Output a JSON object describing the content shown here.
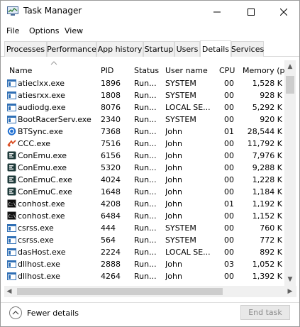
{
  "window": {
    "title": "Task Manager",
    "controls": {
      "minimize": "—",
      "maximize": "☐",
      "close": "✕"
    }
  },
  "menu": [
    "File",
    "Options",
    "View"
  ],
  "tabs": [
    {
      "label": "Processes",
      "active": false
    },
    {
      "label": "Performance",
      "active": false
    },
    {
      "label": "App history",
      "active": false
    },
    {
      "label": "Startup",
      "active": false
    },
    {
      "label": "Users",
      "active": false
    },
    {
      "label": "Details",
      "active": true
    },
    {
      "label": "Services",
      "active": false
    }
  ],
  "columns": {
    "name": "Name",
    "pid": "PID",
    "status": "Status",
    "user": "User name",
    "cpu": "CPU",
    "memory": "Memory (p..."
  },
  "rows": [
    {
      "icon": "window-app-icon",
      "name": "atieclxx.exe",
      "pid": "1896",
      "status": "Run...",
      "user": "SYSTEM",
      "cpu": "00",
      "memory": "1,528 K"
    },
    {
      "icon": "window-app-icon",
      "name": "atiesrxx.exe",
      "pid": "1808",
      "status": "Run...",
      "user": "SYSTEM",
      "cpu": "00",
      "memory": "928 K"
    },
    {
      "icon": "window-app-icon",
      "name": "audiodg.exe",
      "pid": "8076",
      "status": "Run...",
      "user": "LOCAL SE...",
      "cpu": "00",
      "memory": "5,292 K"
    },
    {
      "icon": "window-app-icon",
      "name": "BootRacerServ.exe",
      "pid": "2340",
      "status": "Run...",
      "user": "SYSTEM",
      "cpu": "00",
      "memory": "920 K"
    },
    {
      "icon": "btsync-icon",
      "name": "BTSync.exe",
      "pid": "7368",
      "status": "Run...",
      "user": "John",
      "cpu": "01",
      "memory": "28,544 K"
    },
    {
      "icon": "ccc-icon",
      "name": "CCC.exe",
      "pid": "7516",
      "status": "Run...",
      "user": "John",
      "cpu": "00",
      "memory": "11,792 K"
    },
    {
      "icon": "conemu-icon",
      "name": "ConEmu.exe",
      "pid": "6156",
      "status": "Run...",
      "user": "John",
      "cpu": "00",
      "memory": "7,976 K"
    },
    {
      "icon": "conemu-icon",
      "name": "ConEmu.exe",
      "pid": "5320",
      "status": "Run...",
      "user": "John",
      "cpu": "00",
      "memory": "9,288 K"
    },
    {
      "icon": "conemu-icon",
      "name": "ConEmuC.exe",
      "pid": "4024",
      "status": "Run...",
      "user": "John",
      "cpu": "00",
      "memory": "1,228 K"
    },
    {
      "icon": "conemu-icon",
      "name": "ConEmuC.exe",
      "pid": "1648",
      "status": "Run...",
      "user": "John",
      "cpu": "00",
      "memory": "1,184 K"
    },
    {
      "icon": "console-icon",
      "name": "conhost.exe",
      "pid": "4208",
      "status": "Run...",
      "user": "John",
      "cpu": "01",
      "memory": "1,192 K"
    },
    {
      "icon": "console-icon",
      "name": "conhost.exe",
      "pid": "6484",
      "status": "Run...",
      "user": "John",
      "cpu": "00",
      "memory": "1,152 K"
    },
    {
      "icon": "window-app-icon",
      "name": "csrss.exe",
      "pid": "444",
      "status": "Run...",
      "user": "SYSTEM",
      "cpu": "00",
      "memory": "760 K"
    },
    {
      "icon": "window-app-icon",
      "name": "csrss.exe",
      "pid": "564",
      "status": "Run...",
      "user": "SYSTEM",
      "cpu": "00",
      "memory": "772 K"
    },
    {
      "icon": "window-app-icon",
      "name": "dasHost.exe",
      "pid": "2224",
      "status": "Run...",
      "user": "LOCAL SE...",
      "cpu": "00",
      "memory": "892 K"
    },
    {
      "icon": "window-app-icon",
      "name": "dllhost.exe",
      "pid": "2888",
      "status": "Run...",
      "user": "John",
      "cpu": "03",
      "memory": "1,052 K"
    },
    {
      "icon": "window-app-icon",
      "name": "dllhost.exe",
      "pid": "4264",
      "status": "Run...",
      "user": "John",
      "cpu": "00",
      "memory": "1,392 K"
    }
  ],
  "footer": {
    "fewer_details": "Fewer details",
    "end_task": "End task"
  }
}
